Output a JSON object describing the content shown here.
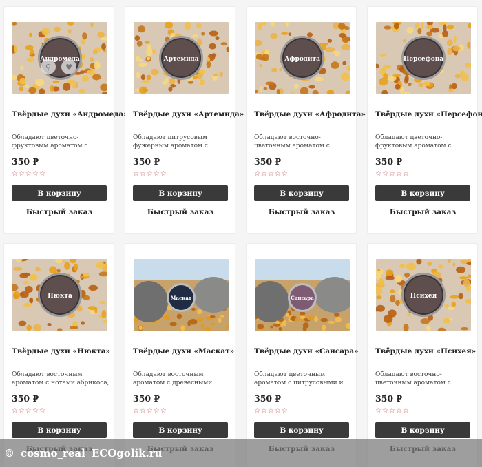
{
  "buttons": {
    "cart_label": "В корзину",
    "quick_label": "Быстрый заказ"
  },
  "stars": "☆☆☆☆☆",
  "products": [
    {
      "title": "Твёрдые духи «Андромеда»",
      "desc": "Обладают цветочно-фруктовым ароматом с",
      "price": "350 ₽",
      "label": "Андромеда",
      "scene": "amber"
    },
    {
      "title": "Твёрдые духи «Артемида»",
      "desc": "Обладают цитрусовым фужерным ароматом с нотами",
      "price": "350 ₽",
      "label": "Артемида",
      "scene": "amber"
    },
    {
      "title": "Твёрдые духи «Афродита»",
      "desc": "Обладают восточно-цветочным ароматом с",
      "price": "350 ₽",
      "label": "Афродита",
      "scene": "amber"
    },
    {
      "title": "Твёрдые духи «Персефона»",
      "desc": "Обладают цветочно-фруктовым ароматом с",
      "price": "350 ₽",
      "label": "Персефона",
      "scene": "amber"
    },
    {
      "title": "Твёрдые духи «Нюкта»",
      "desc": "Обладают восточным ароматом с нотами абрикоса,",
      "price": "350 ₽",
      "label": "Нюкта",
      "scene": "amber"
    },
    {
      "title": "Твёрдые духи «Маскат»",
      "desc": "Обладают восточным ароматом с древесными",
      "price": "350 ₽",
      "label": "Маскат",
      "scene": "stones"
    },
    {
      "title": "Твёрдые духи «Сансара»",
      "desc": "Обладают цветочным ароматом с цитрусовыми и",
      "price": "350 ₽",
      "label": "Сансара",
      "scene": "stones"
    },
    {
      "title": "Твёрдые духи «Психея»",
      "desc": "Обладают восточно-цветочным ароматом с",
      "price": "350 ₽",
      "label": "Психея",
      "scene": "amber"
    }
  ],
  "watermark": {
    "copyright": "©",
    "user": "cosmo_real",
    "site": "ECOgolik.ru"
  }
}
